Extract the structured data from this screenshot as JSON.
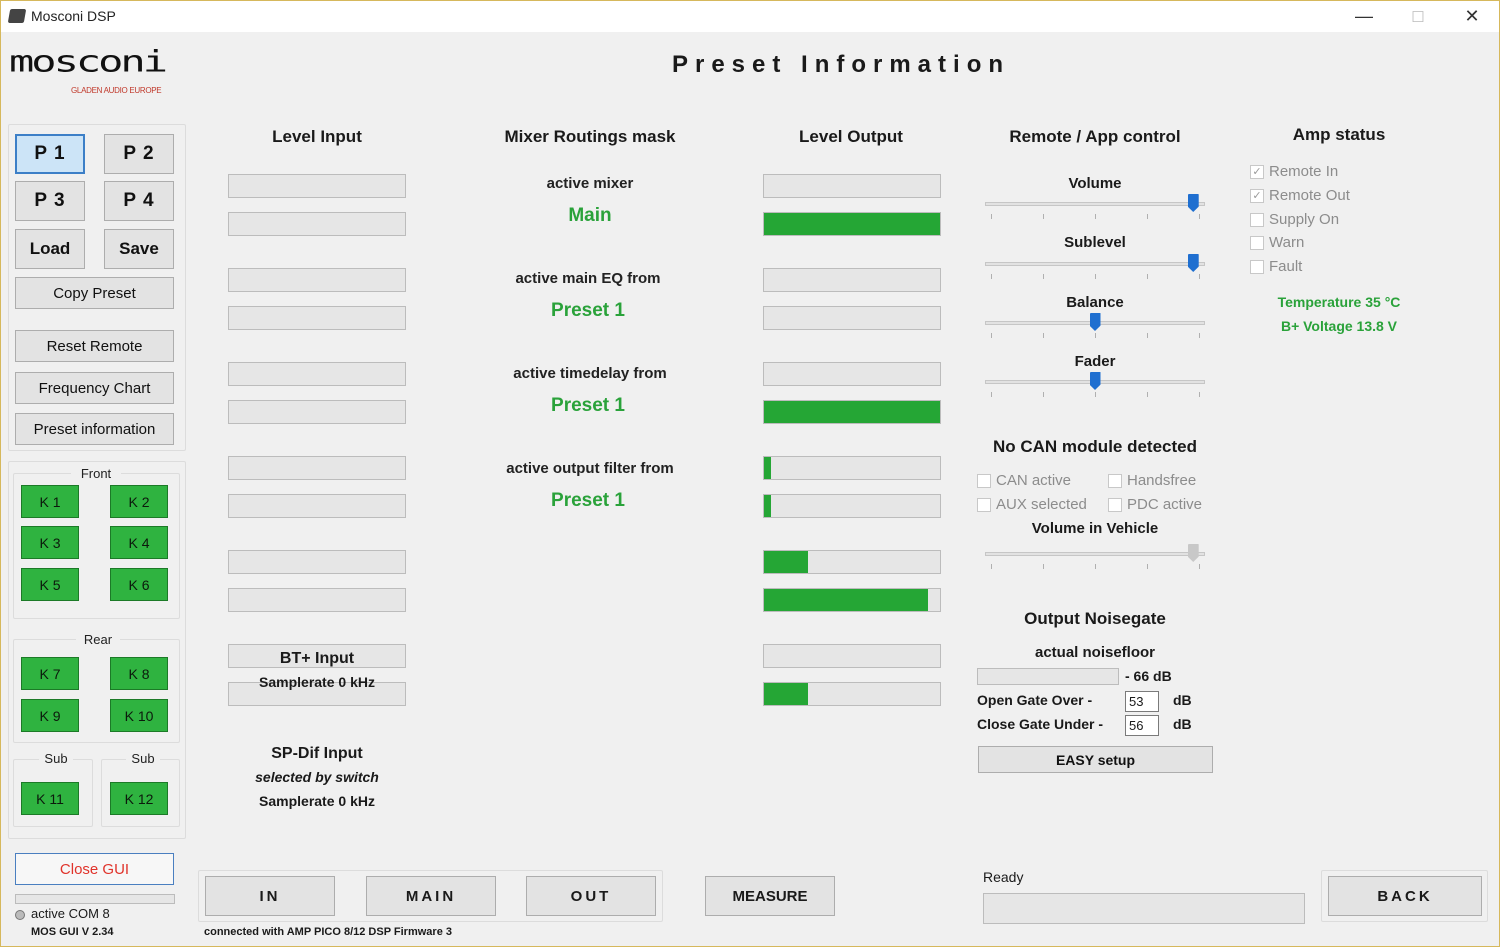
{
  "window": {
    "title": "Mosconi DSP",
    "minimize": "—",
    "maximize": "☐",
    "close": "✕"
  },
  "logo": {
    "text": "mosconi",
    "subtitle": "GLADEN AUDIO EUROPE"
  },
  "page_title": "Preset Information",
  "presets": {
    "p1": "P 1",
    "p2": "P 2",
    "p3": "P 3",
    "p4": "P 4",
    "load": "Load",
    "save": "Save",
    "copy": "Copy Preset",
    "reset_remote": "Reset Remote",
    "frequency_chart": "Frequency Chart",
    "preset_information": "Preset information"
  },
  "channels": {
    "front_label": "Front",
    "rear_label": "Rear",
    "sub_left_label": "Sub",
    "sub_right_label": "Sub",
    "k1": "K 1",
    "k2": "K 2",
    "k3": "K 3",
    "k4": "K 4",
    "k5": "K 5",
    "k6": "K 6",
    "k7": "K 7",
    "k8": "K 8",
    "k9": "K 9",
    "k10": "K 10",
    "k11": "K 11",
    "k12": "K 12"
  },
  "close_gui": "Close GUI",
  "status": {
    "com": "active COM 8",
    "version": "MOS GUI V 2.34",
    "connection": "connected with AMP PICO 8/12 DSP Firmware 3",
    "ready": "Ready"
  },
  "level_input": {
    "title": "Level Input",
    "levels": [
      0,
      0,
      0,
      0,
      0,
      0,
      0,
      0,
      0,
      0,
      0,
      0
    ]
  },
  "bt_input": {
    "title": "BT+ Input",
    "samplerate": "Samplerate 0 kHz"
  },
  "spdif_input": {
    "title": "SP-Dif Input",
    "selected": "selected by switch",
    "samplerate": "Samplerate 0 kHz"
  },
  "mixer": {
    "title": "Mixer  Routings mask",
    "active_mixer_label": "active mixer",
    "active_mixer": "Main",
    "eq_label": "active main EQ from",
    "eq_value": "Preset 1",
    "timedelay_label": "active timedelay from",
    "timedelay_value": "Preset 1",
    "output_filter_label": "active  output filter from",
    "output_filter_value": "Preset 1"
  },
  "level_output": {
    "title": "Level Output",
    "levels": [
      0,
      1.0,
      0,
      0,
      0,
      1.0,
      0.04,
      0.04,
      0.25,
      0.93,
      0,
      0.25
    ]
  },
  "remote": {
    "title": "Remote / App control",
    "volume_label": "Volume",
    "volume": 0.97,
    "sublevel_label": "Sublevel",
    "sublevel": 0.97,
    "balance_label": "Balance",
    "balance": 0.5,
    "fader_label": "Fader",
    "fader": 0.5
  },
  "can": {
    "title": "No CAN module detected",
    "can_active": "CAN active",
    "handsfree": "Handsfree",
    "aux_selected": "AUX selected",
    "pdc_active": "PDC active",
    "volume_vehicle_label": "Volume in Vehicle",
    "volume_vehicle": 0.97
  },
  "noisegate": {
    "title": "Output Noisegate",
    "noisefloor_label": "actual noisefloor",
    "noisefloor_value": "- 66 dB",
    "open_label": "Open Gate Over -",
    "open_value": "53",
    "close_label": "Close Gate Under -",
    "close_value": "56",
    "unit": "dB",
    "easy_setup": "EASY setup"
  },
  "amp_status": {
    "title": "Amp status",
    "remote_in": "Remote In",
    "remote_out": "Remote Out",
    "supply_on": "Supply On",
    "warn": "Warn",
    "fault": "Fault",
    "check": "✓",
    "temperature": "Temperature 35 °C",
    "voltage": "B+ Voltage 13.8 V"
  },
  "nav": {
    "in": "IN",
    "main": "MAIN",
    "out": "OUT",
    "measure": "MEASURE",
    "back": "BACK"
  }
}
